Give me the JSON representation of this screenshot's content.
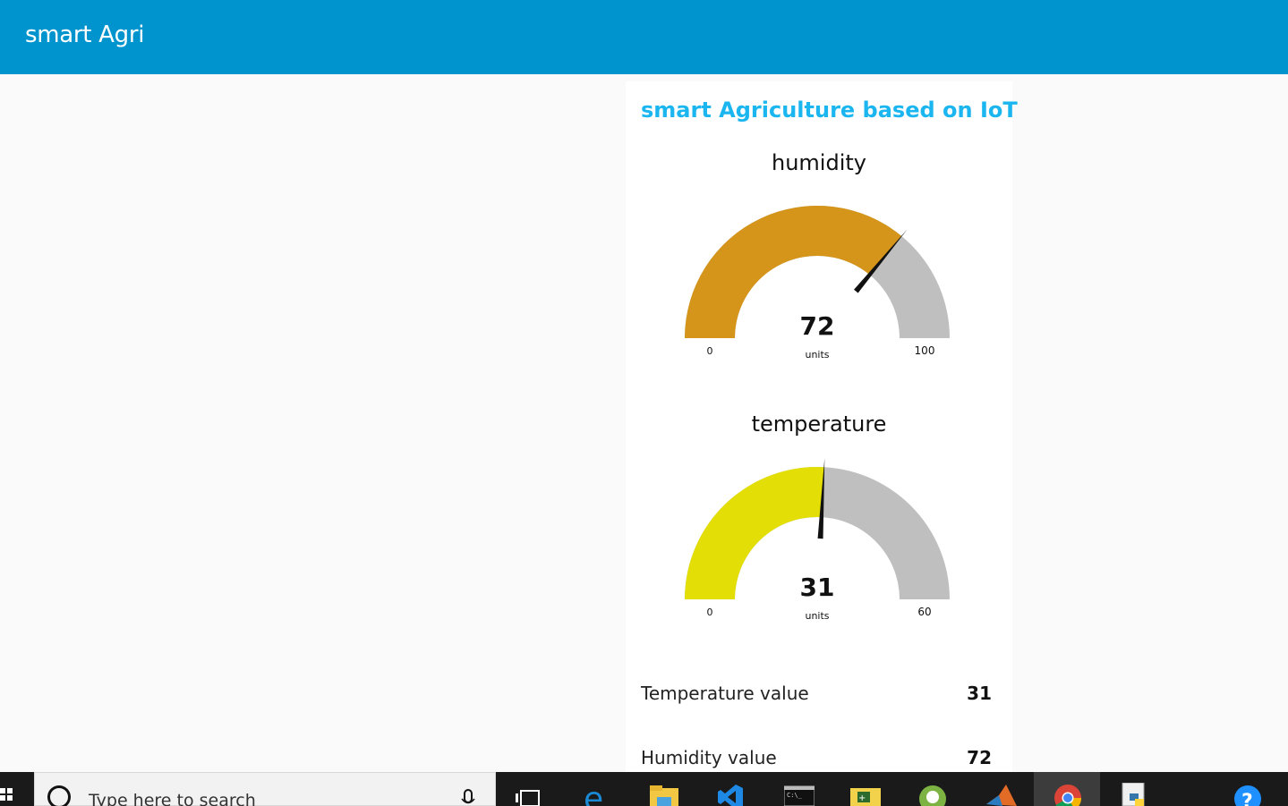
{
  "header": {
    "title": "smart Agri"
  },
  "group": {
    "title": "smart Agriculture based on IoT"
  },
  "gauges": [
    {
      "title": "humidity",
      "value": 72,
      "min": 0,
      "max": 100,
      "min_label": "0",
      "max_label": "100",
      "units": "units",
      "color": "#d4951a",
      "track_color": "#bfbfbf"
    },
    {
      "title": "temperature",
      "value": 31,
      "min": 0,
      "max": 60,
      "min_label": "0",
      "max_label": "60",
      "units": "units",
      "color": "#e3de06",
      "track_color": "#bfbfbf"
    }
  ],
  "text_rows": [
    {
      "label": "Temperature value",
      "value": "31"
    },
    {
      "label": "Humidity value",
      "value": "72"
    }
  ],
  "taskbar": {
    "search_placeholder": "Type here to search",
    "apps": [
      "task-view-icon",
      "edge-icon",
      "file-explorer-icon",
      "vscode-icon",
      "cmd-icon",
      "labview-icon",
      "android-studio-icon",
      "matlab-icon",
      "chrome-icon",
      "python-file-icon",
      "help-icon"
    ],
    "active_app": "chrome-icon"
  }
}
